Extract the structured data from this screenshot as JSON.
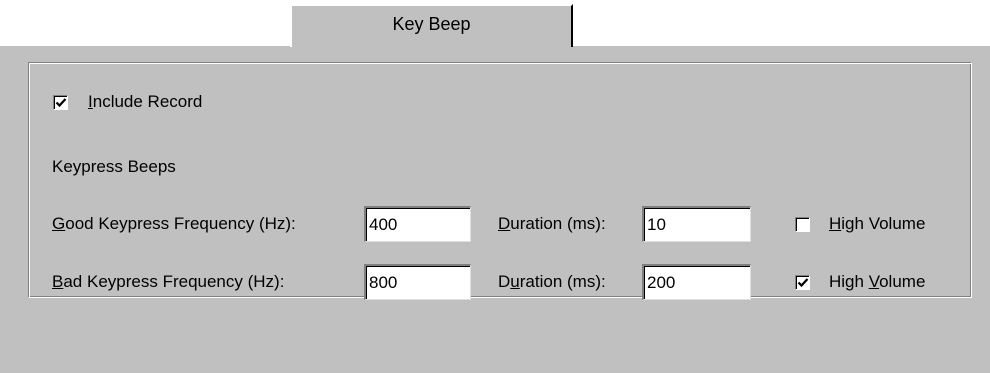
{
  "tab": {
    "label": "Key Beep"
  },
  "include_record": {
    "checked": true,
    "accel": "I",
    "rest": "nclude Record"
  },
  "section_label": "Keypress Beeps",
  "good": {
    "label_accel": "G",
    "label_rest": "ood Keypress Frequency (Hz):",
    "frequency": "400",
    "duration_accel": "D",
    "duration_rest": "uration (ms):",
    "duration": "10",
    "high_volume_checked": false,
    "hv_accel": "H",
    "hv_rest": "igh Volume"
  },
  "bad": {
    "label_accel": "B",
    "label_rest": "ad Keypress Frequency (Hz):",
    "frequency": "800",
    "duration_pre": "D",
    "duration_accel": "u",
    "duration_rest": "ration (ms):",
    "duration": "200",
    "high_volume_checked": true,
    "hv_pre": "High ",
    "hv_accel": "V",
    "hv_rest": "olume"
  }
}
